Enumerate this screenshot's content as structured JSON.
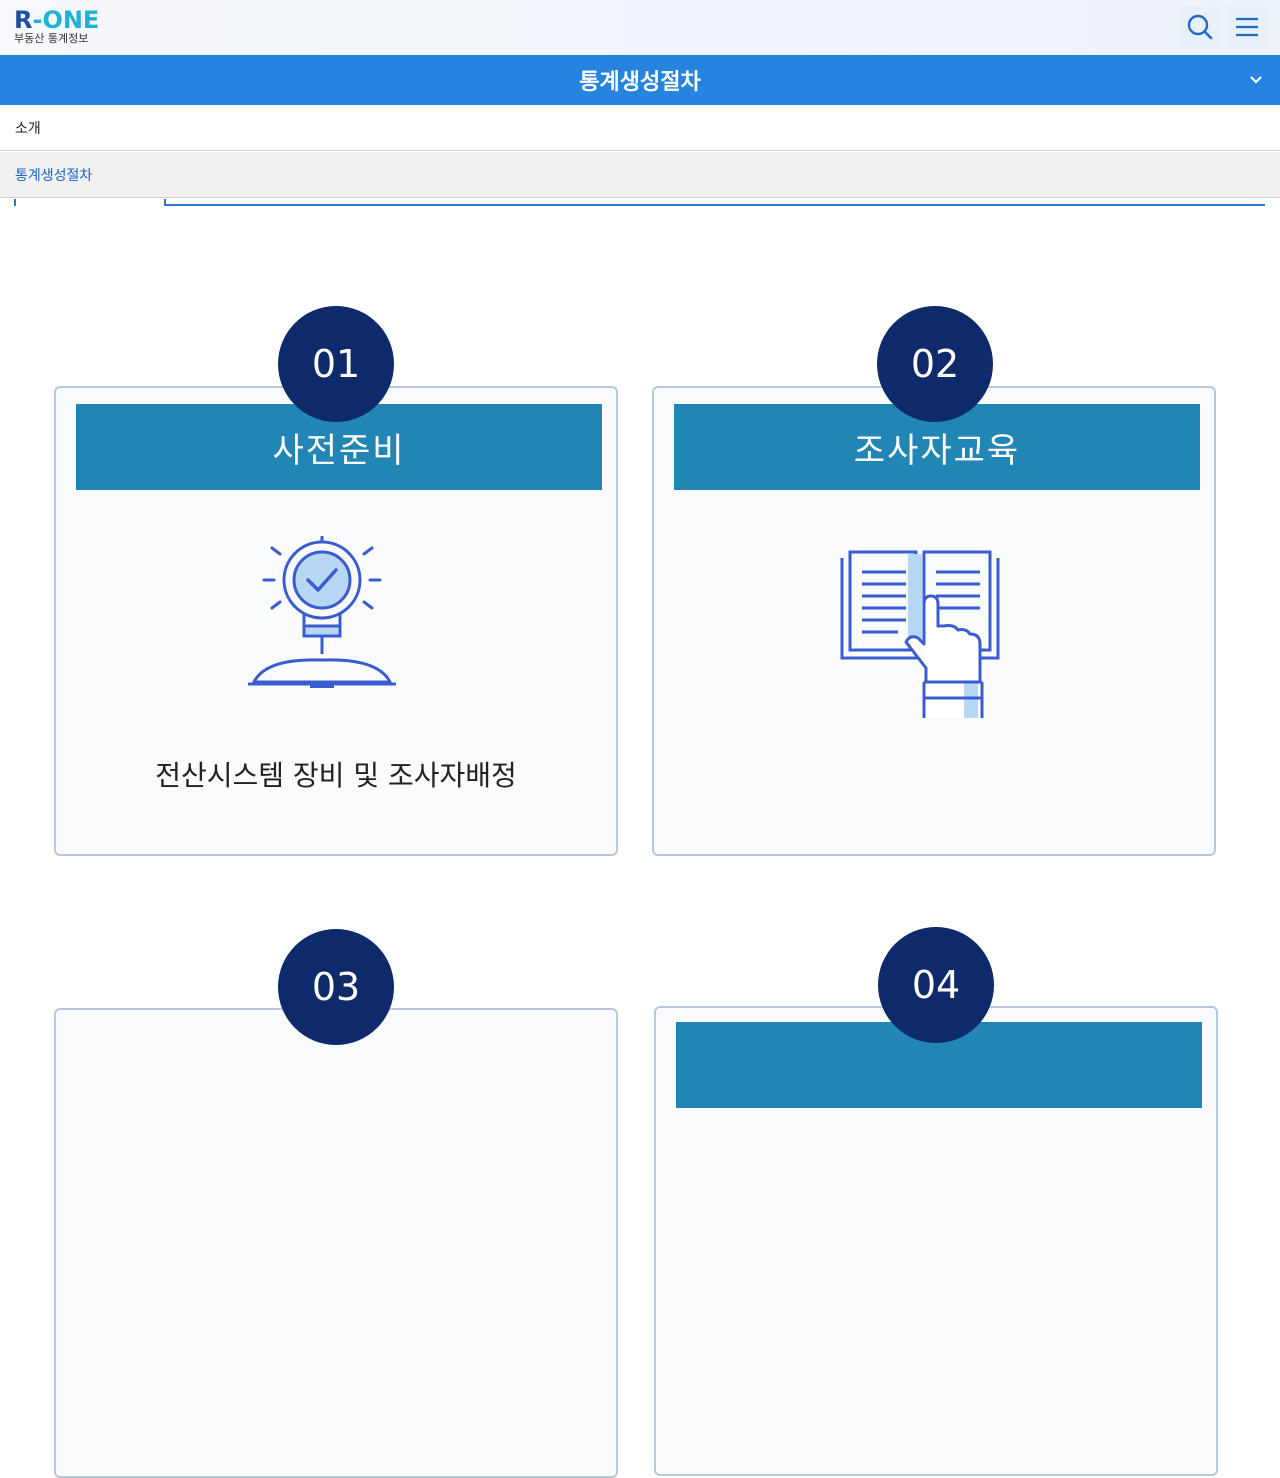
{
  "header": {
    "logo_text": "R-ONE",
    "logo_r": "R",
    "logo_rest": "-ONE",
    "logo_sub": "부동산 통계정보"
  },
  "titlebar": {
    "title": "통계생성절차"
  },
  "dropdown": {
    "items": [
      {
        "label": "소개"
      },
      {
        "label": "통계생성절차"
      }
    ]
  },
  "steps": [
    {
      "num": "01",
      "title": "사전준비",
      "desc": "전산시스템 장비 및 조사자배정",
      "icon": "lightbulb-book-icon"
    },
    {
      "num": "02",
      "title": "조사자교육",
      "desc": "",
      "icon": "open-book-hand-icon"
    },
    {
      "num": "03",
      "title": "",
      "desc": "",
      "icon": ""
    },
    {
      "num": "04",
      "title": "",
      "desc": "",
      "icon": ""
    }
  ],
  "colors": {
    "accent": "#2684e0",
    "card_head": "#2186b4",
    "step_circle": "#0e2a6b",
    "logo_blue": "#1fb2d6"
  }
}
